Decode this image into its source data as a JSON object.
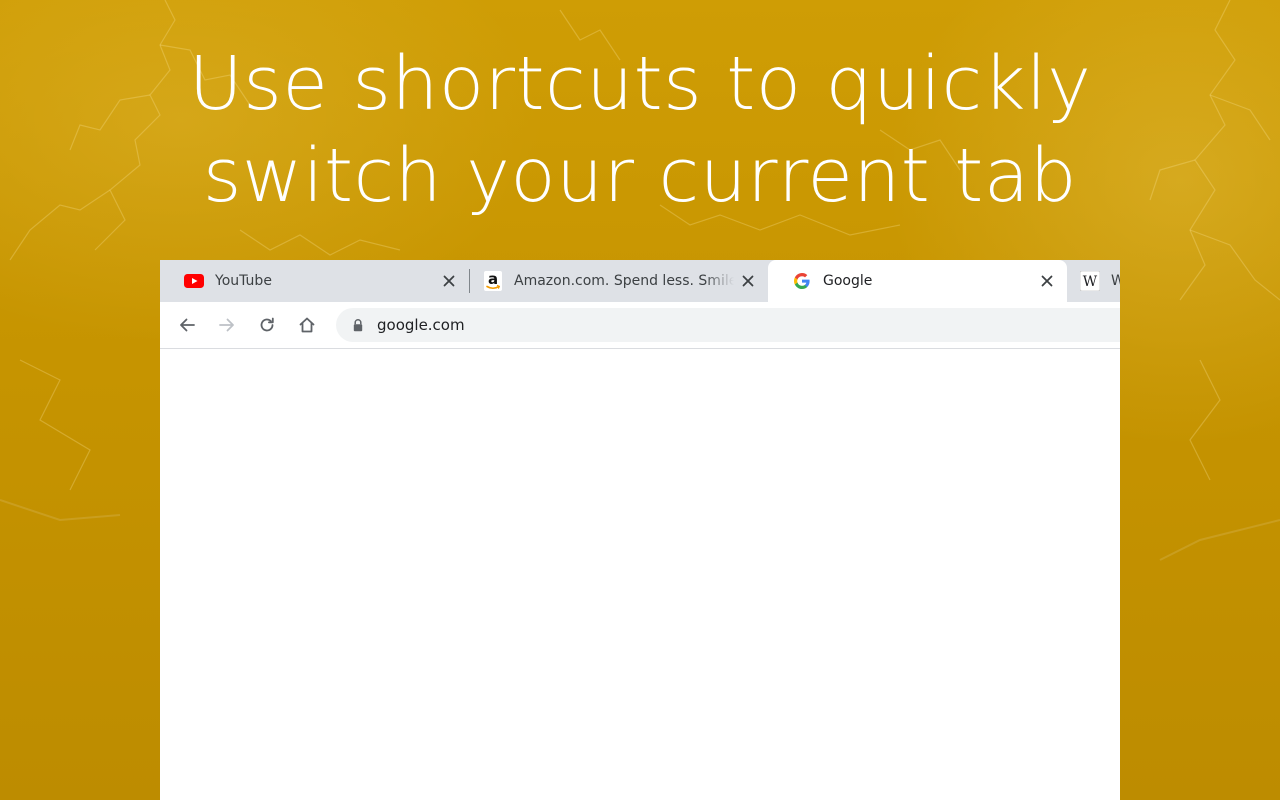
{
  "headline": {
    "line1": "Use shortcuts to quickly",
    "line2": "switch your current tab"
  },
  "browser": {
    "tabs": [
      {
        "title": "YouTube",
        "favicon": "youtube-icon",
        "active": false
      },
      {
        "title": "Amazon.com. Spend less. Smile more.",
        "favicon": "amazon-icon",
        "active": false
      },
      {
        "title": "Google",
        "favicon": "google-icon",
        "active": true
      },
      {
        "title": "W",
        "favicon": "wikipedia-icon",
        "active": false
      }
    ],
    "toolbar": {
      "url": "google.com"
    }
  },
  "colors": {
    "background": "#c69400",
    "tabstrip": "#dee1e6",
    "active_tab": "#ffffff",
    "omnibox": "#f1f3f4",
    "youtube_red": "#ff0000"
  }
}
